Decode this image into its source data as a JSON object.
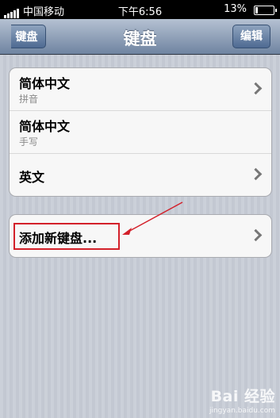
{
  "status_bar": {
    "carrier": "中国移动",
    "time": "下午6:56",
    "battery": "13%"
  },
  "nav": {
    "back_label": "键盘",
    "title": "键盘",
    "edit_label": "编辑"
  },
  "keyboards": [
    {
      "title": "简体中文",
      "subtitle": "拼音"
    },
    {
      "title": "简体中文",
      "subtitle": "手写"
    },
    {
      "title": "英文"
    }
  ],
  "add_keyboard": {
    "label": "添加新键盘..."
  },
  "watermark": {
    "main": "Bai 经验",
    "sub": "jingyan.baidu.com"
  }
}
